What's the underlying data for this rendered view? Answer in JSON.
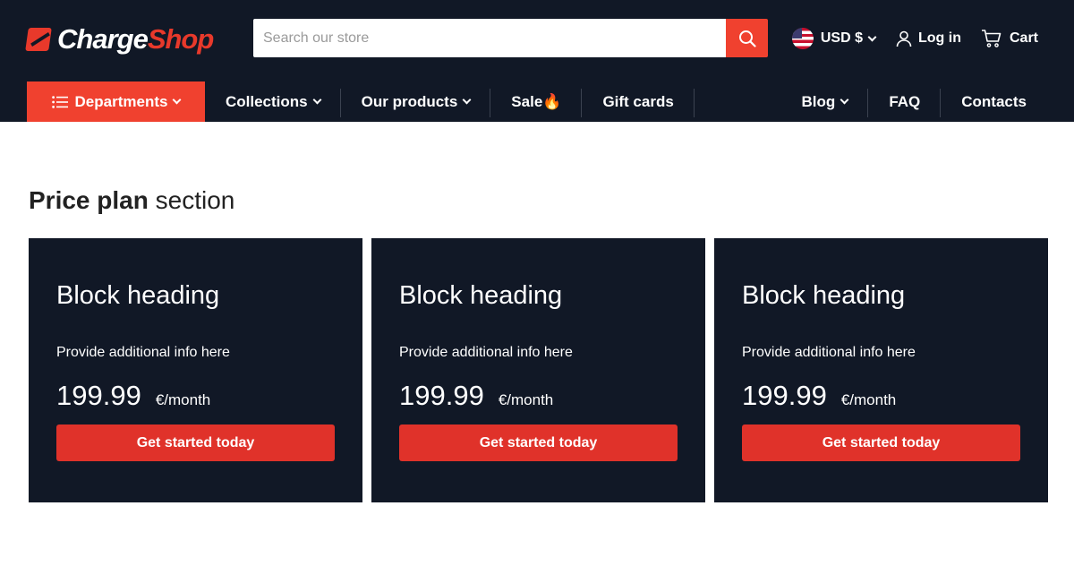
{
  "brand": {
    "name_part1": "Charge",
    "name_part2": "Shop"
  },
  "search": {
    "placeholder": "Search our store",
    "value": ""
  },
  "top_bar": {
    "currency": "USD $",
    "login": "Log in",
    "cart": "Cart"
  },
  "nav": {
    "departments": "Departments",
    "items": [
      {
        "label": "Collections",
        "dropdown": true
      },
      {
        "label": "Our products",
        "dropdown": true
      },
      {
        "label": "Sale🔥",
        "dropdown": false
      },
      {
        "label": "Gift cards",
        "dropdown": false
      }
    ],
    "right_items": [
      {
        "label": "Blog",
        "dropdown": true
      },
      {
        "label": "FAQ",
        "dropdown": false
      },
      {
        "label": "Contacts",
        "dropdown": false
      }
    ]
  },
  "section": {
    "title_bold": "Price plan",
    "title_light": "section"
  },
  "plans": [
    {
      "heading": "Block heading",
      "info": "Provide additional info here",
      "price": "199.99",
      "period": "€/month",
      "cta": "Get started today"
    },
    {
      "heading": "Block heading",
      "info": "Provide additional info here",
      "price": "199.99",
      "period": "€/month",
      "cta": "Get started today"
    },
    {
      "heading": "Block heading",
      "info": "Provide additional info here",
      "price": "199.99",
      "period": "€/month",
      "cta": "Get started today"
    }
  ],
  "colors": {
    "header_bg": "#111826",
    "accent": "#f0412f",
    "button": "#e0322a",
    "card_bg": "#111826"
  }
}
